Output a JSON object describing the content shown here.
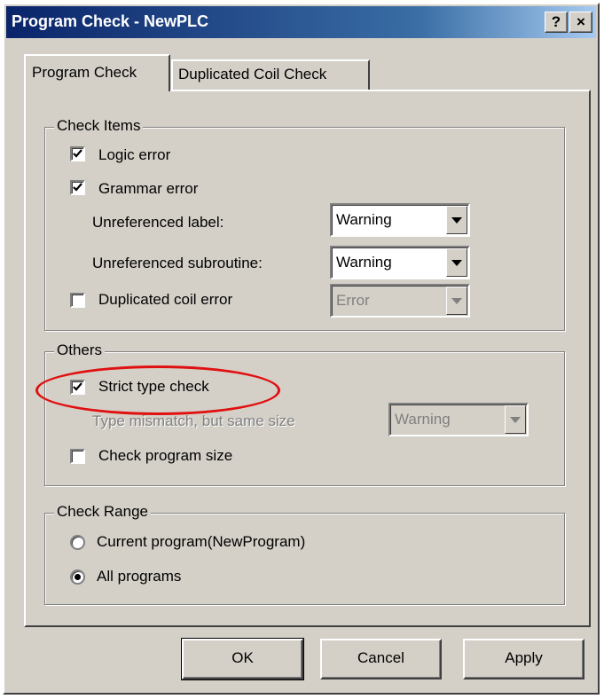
{
  "window": {
    "title": "Program Check - NewPLC",
    "help_button": "?",
    "close_button": "×"
  },
  "tabs": [
    {
      "label": "Program Check",
      "active": true
    },
    {
      "label": "Duplicated Coil Check",
      "active": false
    }
  ],
  "check_items": {
    "legend": "Check Items",
    "logic_error": {
      "label": "Logic error",
      "checked": true
    },
    "grammar_error": {
      "label": "Grammar error",
      "checked": true
    },
    "unreferenced_label": {
      "label": "Unreferenced label:",
      "value": "Warning"
    },
    "unreferenced_subroutine": {
      "label": "Unreferenced subroutine:",
      "value": "Warning"
    },
    "duplicated_coil": {
      "label": "Duplicated coil error",
      "checked": false,
      "value": "Error",
      "enabled": false
    }
  },
  "others": {
    "legend": "Others",
    "strict_type": {
      "label": "Strict type check",
      "checked": true
    },
    "type_mismatch": {
      "label": "Type mismatch, but same size",
      "value": "Warning",
      "enabled": false
    },
    "program_size": {
      "label": "Check program size",
      "checked": false
    }
  },
  "check_range": {
    "legend": "Check Range",
    "options": [
      {
        "label": "Current program(NewProgram)",
        "selected": false
      },
      {
        "label": "All programs",
        "selected": true
      }
    ]
  },
  "buttons": {
    "ok": "OK",
    "cancel": "Cancel",
    "apply": "Apply"
  },
  "colors": {
    "dialog_bg": "#d4d0c8",
    "title_bar": "#0a246a",
    "highlight": "#e01010"
  }
}
